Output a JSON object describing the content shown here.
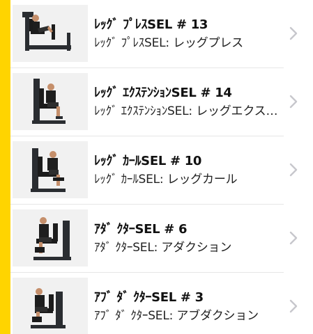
{
  "colors": {
    "accent": "#ffd400",
    "chevron": "#c7c7cc",
    "frame": "#2a2d31",
    "pad": "#1c1c1c",
    "skin": "#c58f6b",
    "shirt": "#1e1e1e",
    "shorts": "#2e2e2e"
  },
  "icons": {
    "chevron": "chevron-right-icon"
  },
  "machines": [
    {
      "title": "ﾚｯｸﾞ ﾌﾟﾚｽSEL # 13",
      "subtitle": "ﾚｯｸﾞ ﾌﾟﾚｽSEL: レッグプレス",
      "image": "leg-press"
    },
    {
      "title": "ﾚｯｸﾞ ｴｸｽﾃﾝｼｮﾝSEL # 14",
      "subtitle": "ﾚｯｸﾞ ｴｸｽﾃﾝｼｮﾝSEL: レッグエクステンション",
      "image": "leg-extension"
    },
    {
      "title": "ﾚｯｸﾞ ｶｰﾙSEL # 10",
      "subtitle": "ﾚｯｸﾞ ｶｰﾙSEL: レッグカール",
      "image": "leg-curl"
    },
    {
      "title": "ｱﾀﾞ ｸﾀｰSEL # 6",
      "subtitle": "ｱﾀﾞ ｸﾀｰSEL: アダクション",
      "image": "adductor"
    },
    {
      "title": "ｱﾌﾞ ﾀﾞ ｸﾀｰSEL # 3",
      "subtitle": "ｱﾌﾞ ﾀﾞ ｸﾀｰSEL: アブダクション",
      "image": "abductor"
    }
  ]
}
